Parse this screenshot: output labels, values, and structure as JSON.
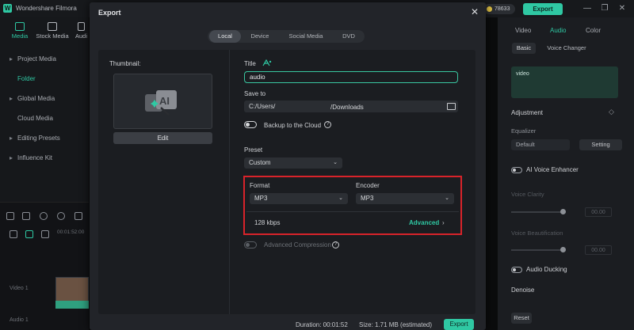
{
  "app": {
    "title": "Wondershare Filmora",
    "logo_letter": "W",
    "coins": "78633",
    "export_label": "Export",
    "window_controls": [
      "—",
      "❐",
      "✕"
    ]
  },
  "left_panel": {
    "tabs": [
      {
        "label": "Media",
        "active": true
      },
      {
        "label": "Stock Media",
        "active": false
      },
      {
        "label": "Audi",
        "active": false
      }
    ],
    "items": [
      {
        "label": "Project Media",
        "arrow": "▸"
      },
      {
        "label": "Folder",
        "arrow": ""
      },
      {
        "label": "Global Media",
        "arrow": "▸"
      },
      {
        "label": "Cloud Media",
        "arrow": ""
      },
      {
        "label": "Editing Presets",
        "arrow": "▸"
      },
      {
        "label": "Influence Kit",
        "arrow": "▸"
      }
    ],
    "timeline": {
      "timecode": "00:01:52:00",
      "video_track": "Video 1",
      "audio_track": "Audio 1"
    }
  },
  "right_panel": {
    "tabs": [
      {
        "label": "Video",
        "active": false
      },
      {
        "label": "Audio",
        "active": true
      },
      {
        "label": "Color",
        "active": false
      }
    ],
    "subtabs": [
      {
        "label": "Basic",
        "active": true
      },
      {
        "label": "Voice Changer",
        "active": false
      }
    ],
    "waveform_label": "video",
    "adjustment_title": "Adjustment",
    "equalizer_label": "Equalizer",
    "equalizer_value": "Default",
    "setting_label": "Setting",
    "ai_voice_enhancer": "AI Voice Enhancer",
    "voice_clarity": "Voice Clarity",
    "voice_clarity_value": "00.00",
    "voice_beautification": "Voice Beautification",
    "voice_beautification_value": "00.00",
    "audio_ducking": "Audio Ducking",
    "denoise": "Denoise",
    "reset": "Reset"
  },
  "dialog": {
    "title": "Export",
    "close": "✕",
    "tabs": [
      {
        "label": "Local",
        "active": true
      },
      {
        "label": "Device",
        "active": false
      },
      {
        "label": "Social Media",
        "active": false
      },
      {
        "label": "DVD",
        "active": false
      }
    ],
    "thumbnail_label": "Thumbnail:",
    "edit_label": "Edit",
    "title_label": "Title",
    "title_value": "audio",
    "save_to_label": "Save to",
    "save_path_start": "C:/Users/",
    "save_path_end": "/Downloads",
    "backup_label": "Backup to the Cloud",
    "preset_label": "Preset",
    "preset_value": "Custom",
    "format_label": "Format",
    "format_value": "MP3",
    "encoder_label": "Encoder",
    "encoder_value": "MP3",
    "bitrate": "128 kbps",
    "advanced_label": "Advanced",
    "advanced_compression": "Advanced Compression",
    "duration_label": "Duration: 00:01:52",
    "size_label": "Size:  1.71 MB (estimated)",
    "export_label": "Export",
    "highlight_color": "#d8232a",
    "accent_color": "#2fc8a3"
  }
}
